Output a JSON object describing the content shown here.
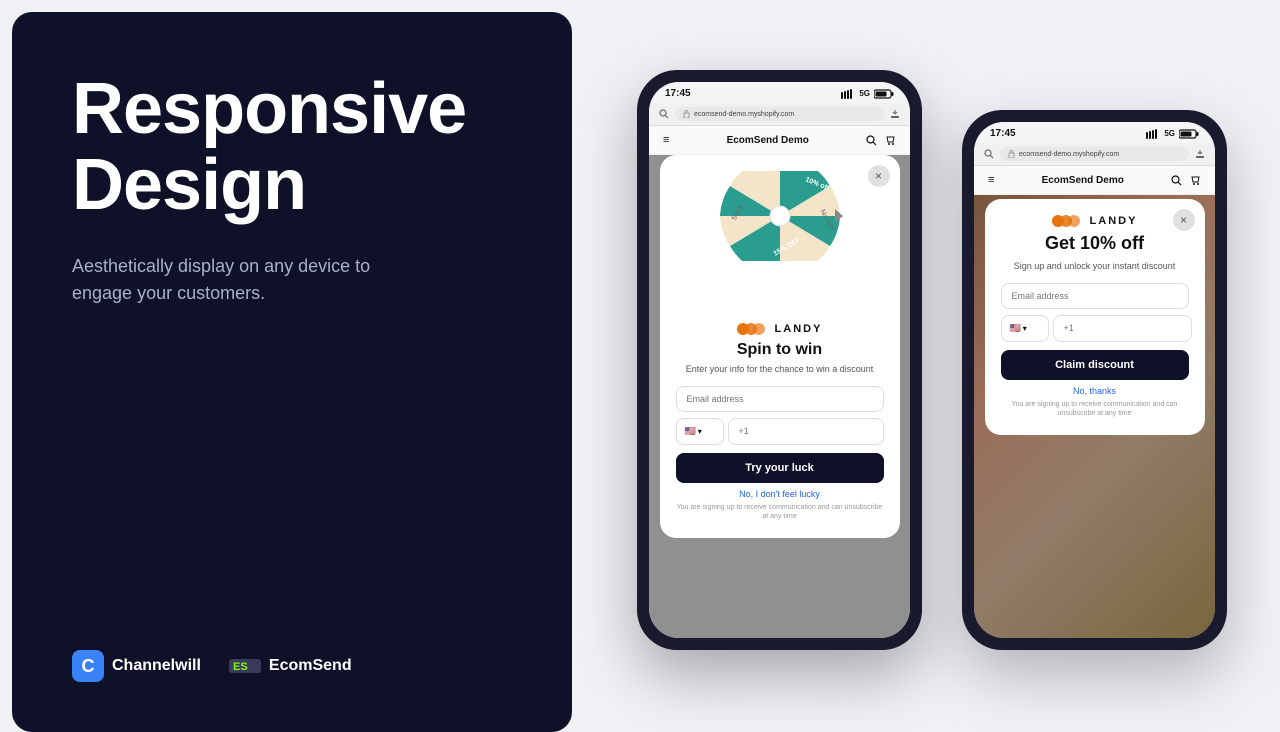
{
  "left": {
    "headline_line1": "Responsive",
    "headline_line2": "Design",
    "subtitle": "Aesthetically display on any device to engage your customers.",
    "brand1_letter": "C",
    "brand1_name": "Channelwill",
    "brand2_name": "EcomSend"
  },
  "phone1": {
    "time": "17:45",
    "signal": "5G",
    "url": "ecomsend-demo.myshopify.com",
    "store_name": "EcomSend Demo",
    "modal": {
      "title": "Spin to win",
      "subtitle": "Enter your info for the chance to win a discount",
      "email_placeholder": "Email address",
      "phone_placeholder": "+1",
      "cta": "Try your luck",
      "secondary_link": "No, I don't feel lucky",
      "legal": "You are signing up to receive communication and can unsubscribe at any time",
      "brand": "LANDY",
      "wheel_segments": [
        "10% off",
        "No luck",
        "15% OFF",
        "Sorry"
      ]
    }
  },
  "phone2": {
    "time": "17:45",
    "signal": "5G",
    "url": "ecomsend-demo.myshopify.com",
    "store_name": "EcomSend Demo",
    "modal": {
      "offer": "Get 10% off",
      "subtitle": "Sign up and unlock your instant discount",
      "email_placeholder": "Email address",
      "phone_placeholder": "+1",
      "cta": "Claim discount",
      "secondary_link": "No, thanks",
      "legal": "You are signing up to receive communication and can unsubscribe at any time",
      "brand": "LANDY"
    }
  },
  "icons": {
    "close": "×",
    "menu": "≡",
    "search": "🔍",
    "cart": "🛒",
    "lock": "🔒",
    "arrow": "▶"
  }
}
